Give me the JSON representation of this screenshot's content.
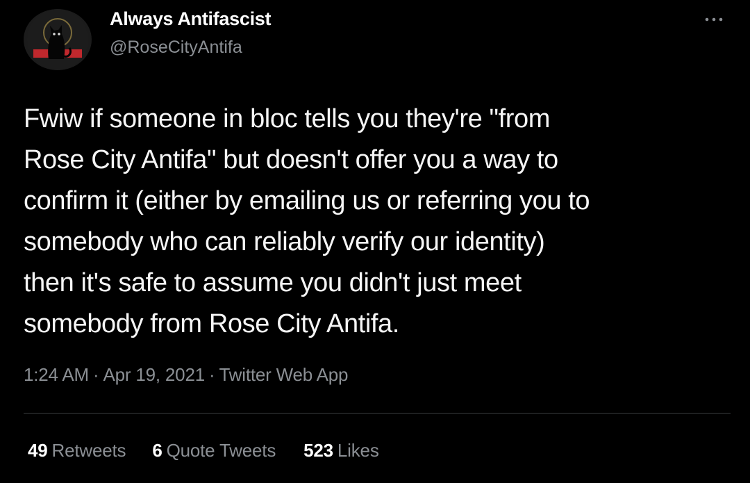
{
  "user": {
    "display_name": "Always Antifascist",
    "handle": "@RoseCityAntifa",
    "avatar_icon": "black-cat-logo"
  },
  "more_icon": "more-options-icon",
  "tweet": {
    "lines": [
      "Fwiw if someone in bloc tells you they're \"from",
      "Rose City Antifa\" but doesn't offer you a way to",
      "confirm it (either by emailing us or referring you to",
      "somebody who can reliably verify our identity)",
      "then it's safe to assume you didn't just meet",
      "somebody from Rose City Antifa."
    ]
  },
  "meta": {
    "time": "1:24 AM",
    "date": "Apr 19, 2021",
    "source": "Twitter Web App",
    "separator": "·"
  },
  "stats": {
    "retweets_count": "49",
    "retweets_label": "Retweets",
    "quote_tweets_count": "6",
    "quote_tweets_label": "Quote Tweets",
    "likes_count": "523",
    "likes_label": "Likes"
  },
  "colors": {
    "background": "#000000",
    "text": "#f5f5f5",
    "secondary": "#8b8f94",
    "avatar_accent": "#c0282d"
  }
}
